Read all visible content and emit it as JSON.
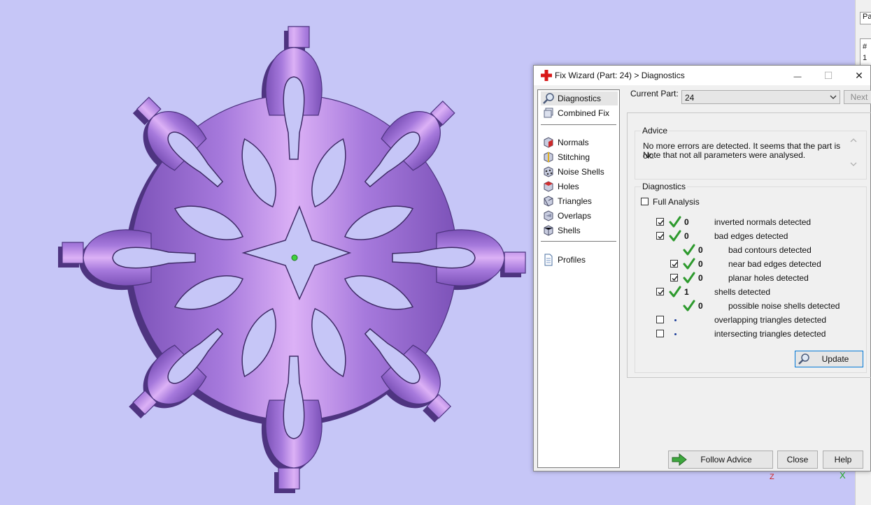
{
  "colors": {
    "viewport_bg": "#c6c6f7",
    "model_light": "#d9a9f2",
    "model_mid": "#a874dc",
    "model_dark": "#6d4aa8",
    "accent_blue": "#0078d7",
    "check_green": "#2d9a2d"
  },
  "right_strip": {
    "tab_label": "Pa",
    "header_hash": "#",
    "row_value": "1"
  },
  "dialog": {
    "title": "Fix Wizard (Part: 24) > Diagnostics",
    "title_icon": "red-cross-icon",
    "window_buttons": {
      "minimize": "—",
      "maximize": "☐",
      "close": "✕"
    }
  },
  "nav": {
    "top": [
      {
        "label": "Diagnostics",
        "icon": "magnifier-icon",
        "selected": true
      },
      {
        "label": "Combined Fix",
        "icon": "stack-icon"
      }
    ],
    "tools": [
      {
        "label": "Normals",
        "icon": "normals-cube-icon"
      },
      {
        "label": "Stitching",
        "icon": "stitching-cube-icon"
      },
      {
        "label": "Noise Shells",
        "icon": "noise-shells-cube-icon"
      },
      {
        "label": "Holes",
        "icon": "holes-cube-icon"
      },
      {
        "label": "Triangles",
        "icon": "triangles-cube-icon"
      },
      {
        "label": "Overlaps",
        "icon": "overlaps-cube-icon"
      },
      {
        "label": "Shells",
        "icon": "shells-cube-icon"
      }
    ],
    "bottom": [
      {
        "label": "Profiles",
        "icon": "document-icon"
      }
    ]
  },
  "current_part": {
    "label": "Current Part:",
    "value": "24",
    "next_label": "Next"
  },
  "advice": {
    "group_title": "Advice",
    "line1": "No more errors are detected. It seems that the part is ok.",
    "line2": "Note that not all parameters were analysed."
  },
  "diagnostics": {
    "group_title": "Diagnostics",
    "full_analysis_label": "Full Analysis",
    "full_analysis_checked": false,
    "rows": [
      {
        "label": "inverted normals detected",
        "count": "0",
        "checked": true,
        "status": "check",
        "indent": 0
      },
      {
        "label": "bad edges detected",
        "count": "0",
        "checked": true,
        "status": "check",
        "indent": 0
      },
      {
        "label": "bad contours detected",
        "count": "0",
        "checked": null,
        "status": "check",
        "indent": 1
      },
      {
        "label": "near bad edges detected",
        "count": "0",
        "checked": true,
        "status": "check",
        "indent": 1
      },
      {
        "label": "planar holes detected",
        "count": "0",
        "checked": true,
        "status": "check",
        "indent": 1
      },
      {
        "label": "shells detected",
        "count": "1",
        "checked": true,
        "status": "check",
        "indent": 0
      },
      {
        "label": "possible noise shells detected",
        "count": "0",
        "checked": null,
        "status": "check",
        "indent": 1
      },
      {
        "label": "overlapping triangles detected",
        "count": "",
        "checked": false,
        "status": "dot",
        "indent": 0
      },
      {
        "label": "intersecting triangles detected",
        "count": "",
        "checked": false,
        "status": "dot",
        "indent": 0
      }
    ],
    "update_label": "Update"
  },
  "buttons": {
    "follow_advice": "Follow Advice",
    "close": "Close",
    "help": "Help"
  },
  "axes": {
    "z": "Z",
    "x": "X"
  }
}
